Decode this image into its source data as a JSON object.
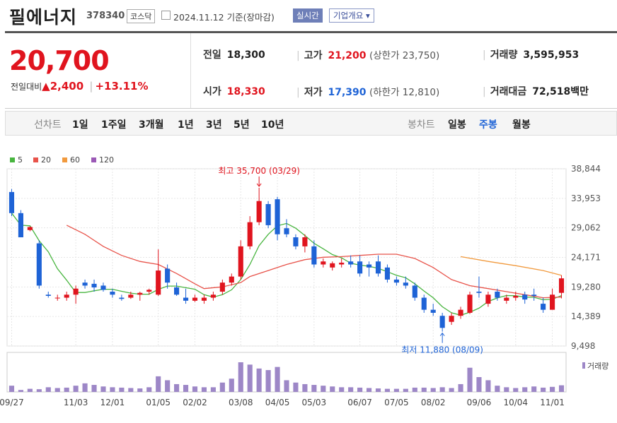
{
  "header": {
    "name": "필에너지",
    "code": "378340",
    "market": "코스닥",
    "date": "2024.11.12",
    "basis": "기준(장마감)",
    "realtime_btn": "실시간",
    "corp_btn": "기업개요"
  },
  "price": {
    "current": "20,700",
    "change_label": "전일대비",
    "change": "2,400",
    "change_pct": "+13.11%",
    "prev_label": "전일",
    "prev": "18,300",
    "open_label": "시가",
    "open": "18,330",
    "high_label": "고가",
    "high": "21,200",
    "high_limit": "(상한가 23,750)",
    "low_label": "저가",
    "low": "17,390",
    "low_limit": "(하한가 12,810)",
    "volume_label": "거래량",
    "volume": "3,595,953",
    "amount_label": "거래대금",
    "amount": "72,518",
    "amount_unit": "백만"
  },
  "tabs": {
    "line_label": "선차트",
    "periods": [
      "1일",
      "1주일",
      "3개월",
      "1년",
      "3년",
      "5년",
      "10년"
    ],
    "candle_label": "봉차트",
    "candle_types": [
      "일봉",
      "주봉",
      "월봉"
    ],
    "candle_selected": "주봉"
  },
  "colors": {
    "up": "#e0141e",
    "down": "#1e63d6",
    "ma5": "#48b53f",
    "ma20": "#e8534a",
    "ma60": "#f19a3e",
    "ma120": "#9b59b6",
    "volume": "#9d87c7"
  },
  "chart_data": {
    "type": "candlestick",
    "interval": "weekly",
    "legend": [
      "5",
      "20",
      "60",
      "120"
    ],
    "y_ticks": [
      9498,
      14389,
      19280,
      24171,
      29062,
      33953,
      38844
    ],
    "ylim": [
      9498,
      38844
    ],
    "x_tick_labels": [
      "09/27",
      "11/03",
      "12/01",
      "01/05",
      "02/02",
      "03/08",
      "04/05",
      "05/03",
      "06/07",
      "07/05",
      "08/02",
      "09/06",
      "10/04",
      "11/01"
    ],
    "x_tick_index": [
      0,
      7,
      11,
      16,
      20,
      25,
      29,
      33,
      38,
      42,
      46,
      51,
      55,
      59
    ],
    "annotations": [
      {
        "text": "최고 35,700 (03/29)",
        "index": 27,
        "value": 35700,
        "pos": "above"
      },
      {
        "text": "최저 11,880 (08/09)",
        "index": 47,
        "value": 11880,
        "pos": "below"
      }
    ],
    "volume_label": "거래량",
    "ohlc": [
      [
        35000,
        35500,
        31000,
        31500
      ],
      [
        31500,
        32000,
        27500,
        27500
      ],
      [
        28700,
        29300,
        28500,
        29200
      ],
      [
        26500,
        27000,
        19000,
        19500
      ],
      [
        18000,
        18500,
        17500,
        17800
      ],
      [
        17500,
        18000,
        17000,
        17500
      ],
      [
        17500,
        18500,
        17000,
        18000
      ],
      [
        18000,
        19500,
        16500,
        19000
      ],
      [
        20000,
        20500,
        19000,
        19500
      ],
      [
        19800,
        20500,
        18500,
        19200
      ],
      [
        19500,
        20000,
        18500,
        18800
      ],
      [
        18500,
        19000,
        17500,
        18000
      ],
      [
        17500,
        18000,
        17000,
        17300
      ],
      [
        17500,
        18500,
        17300,
        18000
      ],
      [
        18000,
        18500,
        17000,
        18300
      ],
      [
        18500,
        19000,
        18000,
        18800
      ],
      [
        18000,
        25500,
        17800,
        22000
      ],
      [
        22300,
        23000,
        19000,
        20000
      ],
      [
        19200,
        20000,
        17800,
        18000
      ],
      [
        17500,
        19000,
        16500,
        17000
      ],
      [
        17000,
        18000,
        16800,
        17500
      ],
      [
        17000,
        18000,
        16500,
        17500
      ],
      [
        17500,
        18500,
        17000,
        18000
      ],
      [
        18500,
        20500,
        18000,
        20000
      ],
      [
        20000,
        21500,
        19500,
        21000
      ],
      [
        21000,
        27000,
        20500,
        26000
      ],
      [
        26000,
        31000,
        25500,
        30000
      ],
      [
        30000,
        35700,
        29500,
        33500
      ],
      [
        33000,
        33500,
        29000,
        29500
      ],
      [
        33800,
        34200,
        27000,
        28000
      ],
      [
        29000,
        30500,
        27500,
        28000
      ],
      [
        27500,
        28000,
        25500,
        26000
      ],
      [
        26000,
        28000,
        25000,
        27500
      ],
      [
        26000,
        27000,
        22500,
        23000
      ],
      [
        23000,
        24000,
        22500,
        23500
      ],
      [
        22500,
        23500,
        22000,
        23200
      ],
      [
        23000,
        24000,
        22500,
        23300
      ],
      [
        23500,
        24500,
        22500,
        23000
      ],
      [
        23500,
        24500,
        21000,
        21500
      ],
      [
        23000,
        23500,
        21000,
        22500
      ],
      [
        23500,
        24500,
        21000,
        21500
      ],
      [
        22500,
        23000,
        20000,
        20500
      ],
      [
        20500,
        21000,
        19500,
        20000
      ],
      [
        20000,
        21000,
        19000,
        19500
      ],
      [
        19500,
        20000,
        17000,
        17500
      ],
      [
        17500,
        18000,
        15000,
        15500
      ],
      [
        15500,
        16500,
        14500,
        15000
      ],
      [
        14500,
        15000,
        11880,
        12500
      ],
      [
        13500,
        15000,
        13000,
        14500
      ],
      [
        14500,
        16000,
        14000,
        15500
      ],
      [
        15000,
        18500,
        14800,
        18000
      ],
      [
        18500,
        21000,
        17500,
        18300
      ],
      [
        16500,
        18500,
        16000,
        18000
      ],
      [
        18500,
        19000,
        17000,
        17500
      ],
      [
        17000,
        18000,
        16500,
        17500
      ],
      [
        17500,
        18500,
        17000,
        17800
      ],
      [
        18000,
        18500,
        16500,
        17200
      ],
      [
        18000,
        19000,
        17000,
        17800
      ],
      [
        16500,
        17500,
        15000,
        15500
      ],
      [
        15500,
        19000,
        15500,
        18000
      ],
      [
        18300,
        21200,
        17390,
        20700
      ]
    ],
    "volume": [
      80,
      25,
      40,
      35,
      60,
      50,
      55,
      80,
      110,
      90,
      70,
      60,
      55,
      50,
      45,
      60,
      200,
      150,
      100,
      90,
      70,
      60,
      60,
      120,
      170,
      380,
      350,
      300,
      280,
      320,
      150,
      120,
      100,
      90,
      80,
      70,
      60,
      60,
      55,
      50,
      45,
      40,
      40,
      40,
      55,
      55,
      50,
      60,
      50,
      100,
      310,
      190,
      150,
      80,
      60,
      50,
      60,
      70,
      55,
      65,
      85
    ],
    "ma20": [
      [
        6,
        29500
      ],
      [
        8,
        28000
      ],
      [
        10,
        26000
      ],
      [
        12,
        24500
      ],
      [
        14,
        23500
      ],
      [
        16,
        23000
      ],
      [
        18,
        21500
      ],
      [
        20,
        19800
      ],
      [
        21,
        19000
      ],
      [
        23,
        19300
      ],
      [
        25,
        20000
      ],
      [
        26,
        21000
      ],
      [
        28,
        22000
      ],
      [
        30,
        23000
      ],
      [
        32,
        23800
      ],
      [
        34,
        24200
      ],
      [
        36,
        24300
      ],
      [
        38,
        24500
      ],
      [
        40,
        24700
      ],
      [
        42,
        24700
      ],
      [
        44,
        24000
      ],
      [
        46,
        22500
      ],
      [
        48,
        20500
      ],
      [
        50,
        19500
      ],
      [
        52,
        19000
      ],
      [
        54,
        18500
      ],
      [
        56,
        18000
      ],
      [
        58,
        17500
      ],
      [
        60,
        17600
      ]
    ],
    "ma60": [
      [
        49,
        24300
      ],
      [
        52,
        23500
      ],
      [
        55,
        22800
      ],
      [
        58,
        22000
      ],
      [
        60,
        21200
      ]
    ]
  }
}
